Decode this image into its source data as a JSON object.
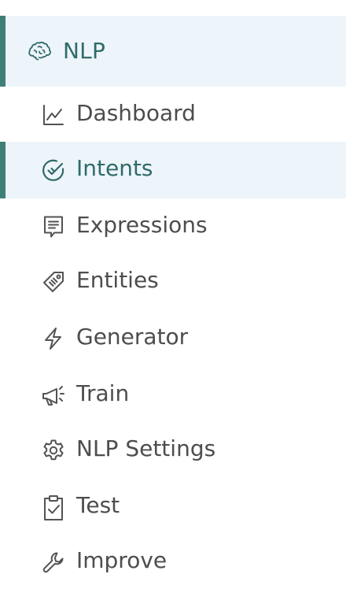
{
  "section": {
    "label": "NLP",
    "icon": "brain-icon"
  },
  "items": [
    {
      "label": "Dashboard",
      "icon": "line-chart-icon",
      "active": false
    },
    {
      "label": "Intents",
      "icon": "circle-check-icon",
      "active": true
    },
    {
      "label": "Expressions",
      "icon": "message-square-icon",
      "active": false
    },
    {
      "label": "Entities",
      "icon": "tag-icon",
      "active": false
    },
    {
      "label": "Generator",
      "icon": "lightning-icon",
      "active": false
    },
    {
      "label": "Train",
      "icon": "megaphone-icon",
      "active": false
    },
    {
      "label": "NLP Settings",
      "icon": "gear-icon",
      "active": false
    },
    {
      "label": "Test",
      "icon": "clipboard-check-icon",
      "active": false
    },
    {
      "label": "Improve",
      "icon": "wrench-icon",
      "active": false
    }
  ],
  "colors": {
    "accent": "#3e7f78",
    "accent_text": "#2f6b69",
    "active_bg": "#eef5fa",
    "text": "#4d4d4d",
    "icon": "#535353"
  }
}
